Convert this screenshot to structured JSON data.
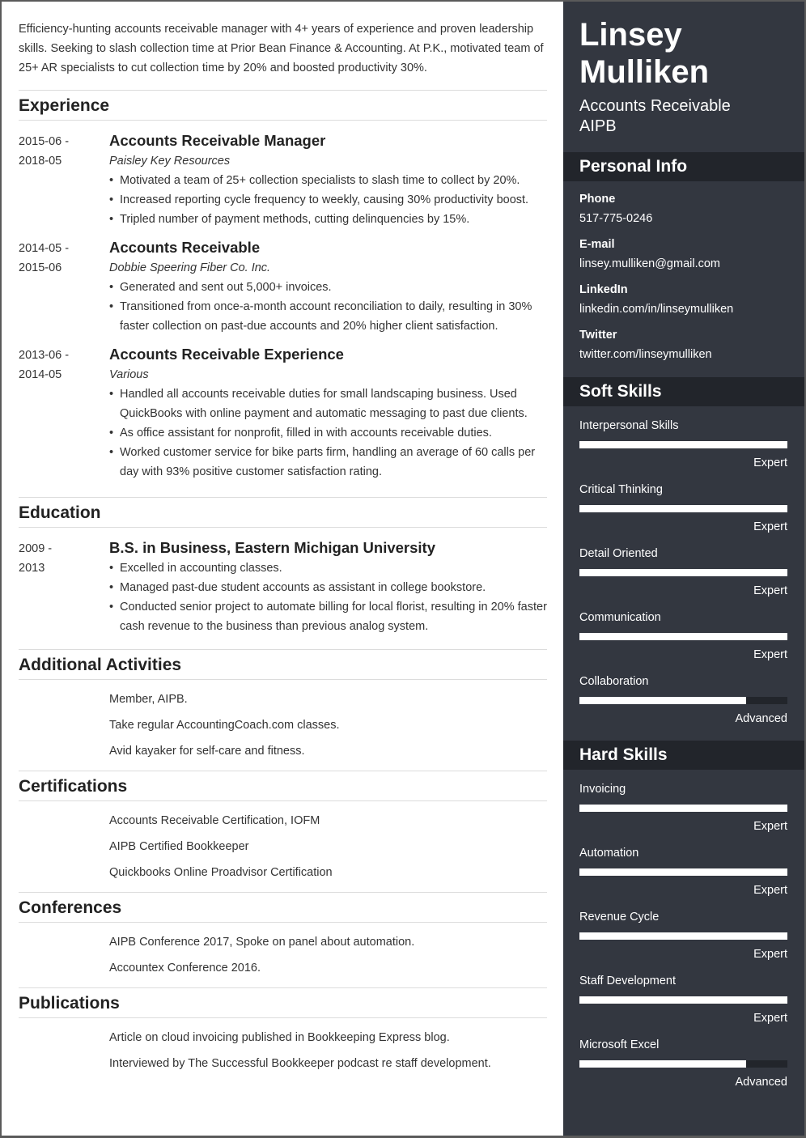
{
  "header": {
    "name_line1": "Linsey",
    "name_line2": "Mulliken",
    "title_line1": "Accounts Receivable",
    "title_line2": "AIPB"
  },
  "summary": "Efficiency-hunting accounts receivable manager with 4+ years of experience and proven leadership skills. Seeking to slash collection time at Prior Bean Finance & Accounting. At P.K., motivated team of 25+ AR specialists to cut collection time by 20% and boosted productivity 30%.",
  "experience": {
    "heading": "Experience",
    "items": [
      {
        "date_start": "2015-06 -",
        "date_end": "2018-05",
        "role": "Accounts Receivable Manager",
        "company": "Paisley Key Resources",
        "bullets": [
          "Motivated a team of 25+ collection specialists to slash time to collect by 20%.",
          "Increased reporting cycle frequency to weekly, causing 30% productivity boost.",
          "Tripled number of payment methods, cutting delinquencies by 15%."
        ]
      },
      {
        "date_start": "2014-05 -",
        "date_end": "2015-06",
        "role": "Accounts Receivable",
        "company": "Dobbie Speering Fiber Co. Inc.",
        "bullets": [
          "Generated and sent out 5,000+ invoices.",
          "Transitioned from once-a-month account reconciliation to daily, resulting in 30% faster collection on past-due accounts and 20% higher client satisfaction."
        ]
      },
      {
        "date_start": "2013-06 -",
        "date_end": "2014-05",
        "role": "Accounts Receivable Experience",
        "company": "Various",
        "bullets": [
          "Handled all accounts receivable duties for small landscaping business. Used QuickBooks with online payment and automatic messaging to past due clients.",
          "As office assistant for nonprofit, filled in with accounts receivable duties.",
          "Worked customer service for bike parts firm, handling an average of 60 calls per day with 93% positive customer satisfaction rating."
        ]
      }
    ]
  },
  "education": {
    "heading": "Education",
    "items": [
      {
        "date_start": "2009 -",
        "date_end": "2013",
        "degree": "B.S. in Business, Eastern Michigan University",
        "bullets": [
          "Excelled in accounting classes.",
          "Managed past-due student accounts as assistant in college bookstore.",
          "Conducted senior project to automate billing for local florist, resulting in 20% faster cash revenue to the business than previous analog system."
        ]
      }
    ]
  },
  "activities": {
    "heading": "Additional Activities",
    "items": [
      "Member, AIPB.",
      "Take regular AccountingCoach.com classes.",
      "Avid kayaker for self-care and fitness."
    ]
  },
  "certifications": {
    "heading": "Certifications",
    "items": [
      "Accounts Receivable Certification, IOFM",
      "AIPB Certified Bookkeeper",
      "Quickbooks Online Proadvisor Certification"
    ]
  },
  "conferences": {
    "heading": "Conferences",
    "items": [
      "AIPB Conference 2017, Spoke on panel about automation.",
      "Accountex Conference 2016."
    ]
  },
  "publications": {
    "heading": "Publications",
    "items": [
      "Article on cloud invoicing published in Bookkeeping Express blog.",
      "Interviewed by The Successful Bookkeeper podcast re staff development."
    ]
  },
  "personal_info": {
    "heading": "Personal Info",
    "fields": [
      {
        "label": "Phone",
        "value": "517-775-0246"
      },
      {
        "label": "E-mail",
        "value": "linsey.mulliken@gmail.com"
      },
      {
        "label": "LinkedIn",
        "value": "linkedin.com/in/linseymulliken"
      },
      {
        "label": "Twitter",
        "value": "twitter.com/linseymulliken"
      }
    ]
  },
  "soft_skills": {
    "heading": "Soft Skills",
    "items": [
      {
        "name": "Interpersonal Skills",
        "level": "Expert",
        "percent": 100
      },
      {
        "name": "Critical Thinking",
        "level": "Expert",
        "percent": 100
      },
      {
        "name": "Detail Oriented",
        "level": "Expert",
        "percent": 100
      },
      {
        "name": "Communication",
        "level": "Expert",
        "percent": 100
      },
      {
        "name": "Collaboration",
        "level": "Advanced",
        "percent": 80
      }
    ]
  },
  "hard_skills": {
    "heading": "Hard Skills",
    "items": [
      {
        "name": "Invoicing",
        "level": "Expert",
        "percent": 100
      },
      {
        "name": "Automation",
        "level": "Expert",
        "percent": 100
      },
      {
        "name": "Revenue Cycle",
        "level": "Expert",
        "percent": 100
      },
      {
        "name": "Staff Development",
        "level": "Expert",
        "percent": 100
      },
      {
        "name": "Microsoft Excel",
        "level": "Advanced",
        "percent": 80
      }
    ]
  }
}
